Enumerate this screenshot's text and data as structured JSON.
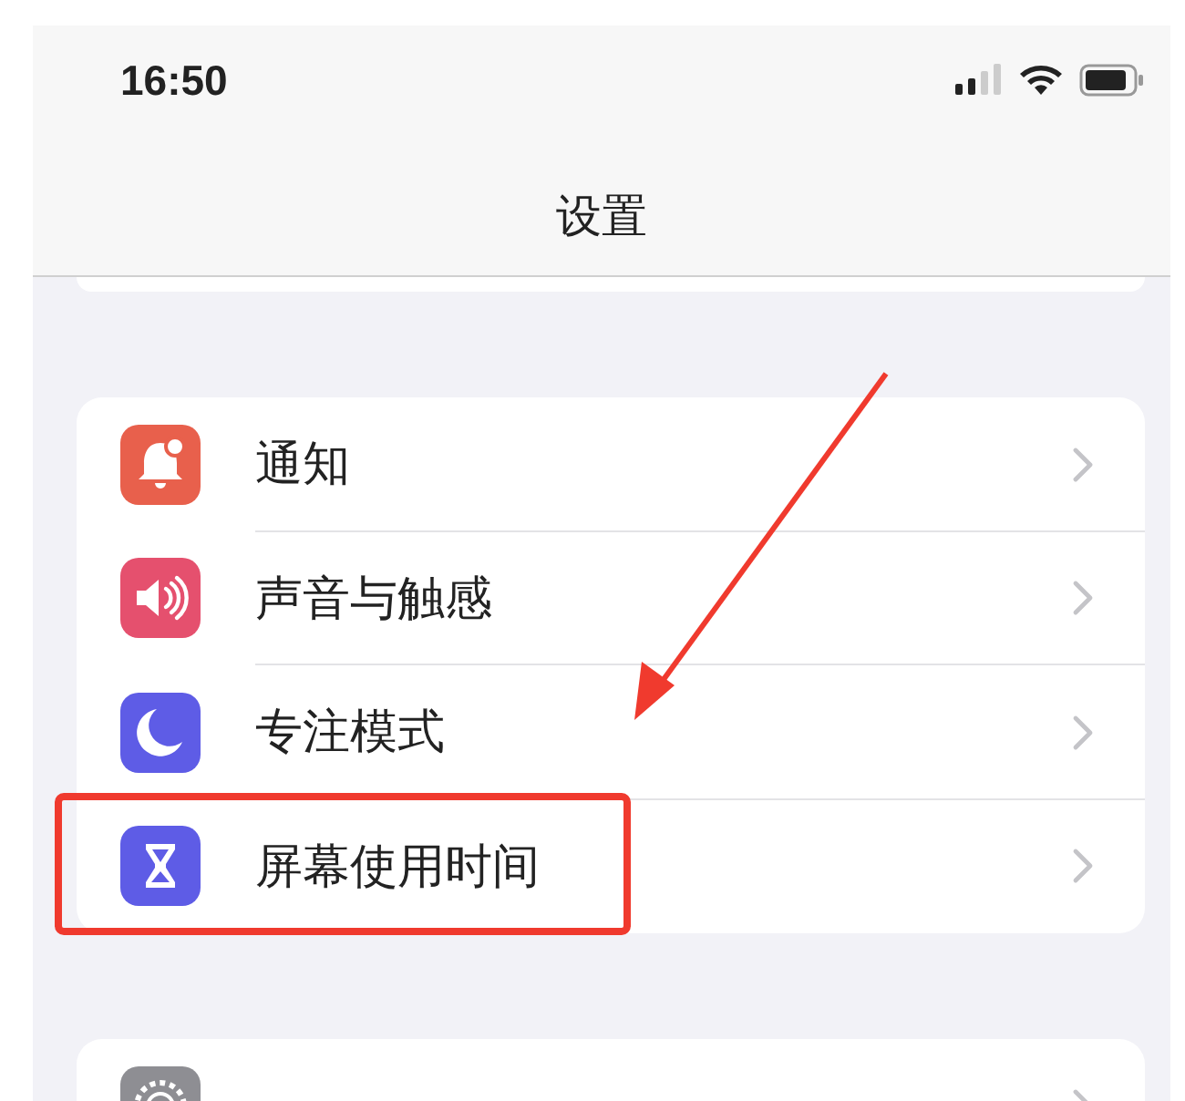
{
  "status_bar": {
    "time": "16:50"
  },
  "nav": {
    "title": "设置"
  },
  "groups": [
    {
      "items": [
        {
          "label": "通知",
          "color": "#e8604c",
          "highlighted": false
        },
        {
          "label": "声音与触感",
          "color": "#e5506e",
          "highlighted": false
        },
        {
          "label": "专注模式",
          "color": "#5e5ce6",
          "highlighted": false
        },
        {
          "label": "屏幕使用时间",
          "color": "#5e5ce6",
          "highlighted": true
        }
      ]
    },
    {
      "items": [
        {
          "color": "#8e8e93",
          "highlighted": false
        }
      ]
    }
  ]
}
